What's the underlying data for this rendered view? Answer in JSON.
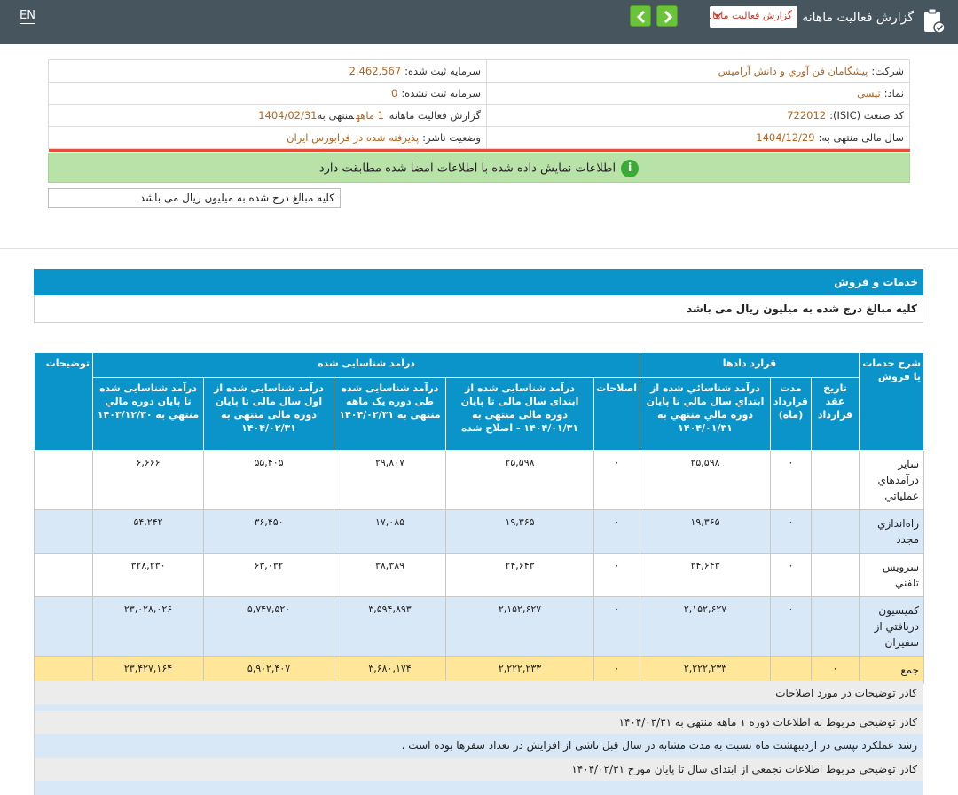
{
  "header": {
    "lang": "EN",
    "title": "گزارش فعالیت ماهانه",
    "report_type": "گزارش فعالیت ماهانه",
    "icons": {
      "doc": "clipboard-icon",
      "prev": "chevron-left-icon",
      "next": "chevron-right-icon"
    }
  },
  "info": {
    "company_label": "شرکت:",
    "company_value": "پيشگامان فن آوري و دانش آراميس",
    "registered_capital_label": "سرمایه ثبت شده:",
    "registered_capital_value": "2,462,567",
    "symbol_label": "نماد:",
    "symbol_value": "تپسي",
    "unregistered_capital_label": "سرمایه ثبت نشده:",
    "unregistered_capital_value": "0",
    "isic_label": "کد صنعت (ISIC):",
    "isic_value": "722012",
    "period_label_a": "گزارش فعالیت ماهانه",
    "period_value_a": "1 ماهه",
    "period_label_b": "منتهی به",
    "period_value_b": "1404/02/31",
    "fiscal_label": "سال مالی منتهی به:",
    "fiscal_value": "1404/12/29",
    "status_label": "وضعیت ناشر:",
    "status_value": "پذيرفته شده در فرابورس ايران",
    "verified_text": "اطلاعات نمایش داده شده با اطلاعات امضا شده مطابقت دارد",
    "amount_note": "کلیه مبالغ درج شده به میلیون ریال می باشد"
  },
  "section": {
    "title": "خدمات و فروش",
    "note": "کلیه مبالغ درج شده به میلیون ریال می باشد"
  },
  "table": {
    "h_desc": "شرح خدمات یا فروش",
    "h_contracts": "قرارد دادها",
    "h_revenue": "درآمد شناسایی شده",
    "h_notes": "توضیحات",
    "h_contract_date": "تاريخ عقد قرارداد",
    "h_contract_duration": "مدت قرارداد (ماه)",
    "h_c1": "درآمد شناسائي شده از ابتداي سال مالي تا پايان دوره مالي منتهي به ۱۴۰۴/۰۱/۳۱",
    "h_c2": "اصلاحات",
    "h_c3": "درآمد شناسایی شده از ابتدای سال مالی تا پایان دوره مالی منتهی به ۱۴۰۴/۰۱/۳۱ - اصلاح شده",
    "h_c4": "درآمد شناسایی شده طی دوره یک ماهه منتهی به ۱۴۰۴/۰۲/۳۱",
    "h_c5": "درآمد شناسایی شده از اول سال مالی تا پایان دوره مالی منتهی به ۱۴۰۴/۰۲/۳۱",
    "h_c6": "درآمد شناسایی شده تا پایان دوره مالي منتهي به ۱۴۰۳/۱۲/۳۰",
    "rows": [
      {
        "name": "ساير درآمدهاي عملياتي",
        "date": "",
        "duration": "۰",
        "c1": "۲۵,۵۹۸",
        "c2": "۰",
        "c3": "۲۵,۵۹۸",
        "c4": "۲۹,۸۰۷",
        "c5": "۵۵,۴۰۵",
        "c6": "۶,۶۶۶",
        "notes": ""
      },
      {
        "name": "راه‌اندازي مجدد",
        "date": "",
        "duration": "۰",
        "c1": "۱۹,۳۶۵",
        "c2": "۰",
        "c3": "۱۹,۳۶۵",
        "c4": "۱۷,۰۸۵",
        "c5": "۳۶,۴۵۰",
        "c6": "۵۴,۲۴۲",
        "notes": ""
      },
      {
        "name": "سرويس تلفني",
        "date": "",
        "duration": "۰",
        "c1": "۲۴,۶۴۳",
        "c2": "۰",
        "c3": "۲۴,۶۴۳",
        "c4": "۳۸,۳۸۹",
        "c5": "۶۳,۰۳۲",
        "c6": "۳۲۸,۲۳۰",
        "notes": ""
      },
      {
        "name": "کميسيون دريافتي از سفيران",
        "date": "",
        "duration": "۰",
        "c1": "۲,۱۵۲,۶۲۷",
        "c2": "۰",
        "c3": "۲,۱۵۲,۶۲۷",
        "c4": "۳,۵۹۴,۸۹۳",
        "c5": "۵,۷۴۷,۵۲۰",
        "c6": "۲۳,۰۲۸,۰۲۶",
        "notes": ""
      }
    ],
    "total": {
      "name": "جمع",
      "date": "۰",
      "c1": "۲,۲۲۲,۲۳۳",
      "c2": "۰",
      "c3": "۲,۲۲۲,۲۳۳",
      "c4": "۳,۶۸۰,۱۷۴",
      "c5": "۵,۹۰۲,۴۰۷",
      "c6": "۲۳,۴۲۷,۱۶۴"
    }
  },
  "comments": {
    "corrections_title": "کادر توضیحات در مورد اصلاحات",
    "period_title": "کادر توضیحي مربوط به اطلاعات دوره ۱ ماهه منتهی به ۱۴۰۴/۰۲/۳۱",
    "period_text": "رشد عملکرد تپسی در اردیبهشت ماه نسبت به مدت مشابه در سال قبل ناشی از افزایش در تعداد سفرها بوده است .",
    "cumulative_title": "کادر توضیحي مربوط اطلاعات تجمعی از ابتدای سال تا پایان مورخ ۱۴۰۴/۰۲/۳۱"
  },
  "colors": {
    "header_bg": "#47555f",
    "accent": "#0b94c9",
    "verified_bg": "#b8e2a8",
    "total_bg": "#ffe699",
    "row_alt": "#d8e8f6"
  }
}
